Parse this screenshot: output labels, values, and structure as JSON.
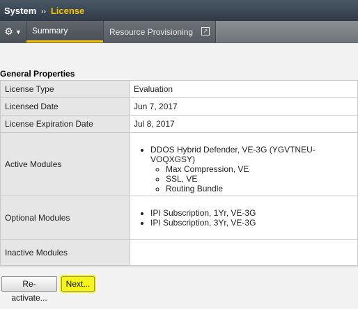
{
  "header": {
    "crumbs": [
      "System",
      "License"
    ],
    "separator": "››"
  },
  "tabs": {
    "gear_icon": "gear-icon",
    "items": [
      {
        "label": "Summary",
        "active": true
      },
      {
        "label": "Resource Provisioning",
        "active": false
      }
    ],
    "external_icon": "↗"
  },
  "section": {
    "title": "General Properties"
  },
  "properties": {
    "license_type": {
      "label": "License Type",
      "value": "Evaluation"
    },
    "licensed_date": {
      "label": "Licensed Date",
      "value": "Jun 7, 2017"
    },
    "expiration_date": {
      "label": "License Expiration Date",
      "value": "Jul 8, 2017"
    },
    "active_modules": {
      "label": "Active Modules",
      "primary": "DDOS Hybrid Defender, VE-3G (YGVTNEU-VOQXGSY)",
      "sub": [
        "Max Compression, VE",
        "SSL, VE",
        "Routing Bundle"
      ]
    },
    "optional_modules": {
      "label": "Optional Modules",
      "items": [
        "IPI Subscription, 1Yr, VE-3G",
        "IPI Subscription, 3Yr, VE-3G"
      ]
    },
    "inactive_modules": {
      "label": "Inactive Modules",
      "value": ""
    }
  },
  "buttons": {
    "reactivate": "Re-activate...",
    "next": "Next..."
  },
  "colors": {
    "accent": "#f3c300",
    "highlight": "#f6f51a"
  }
}
